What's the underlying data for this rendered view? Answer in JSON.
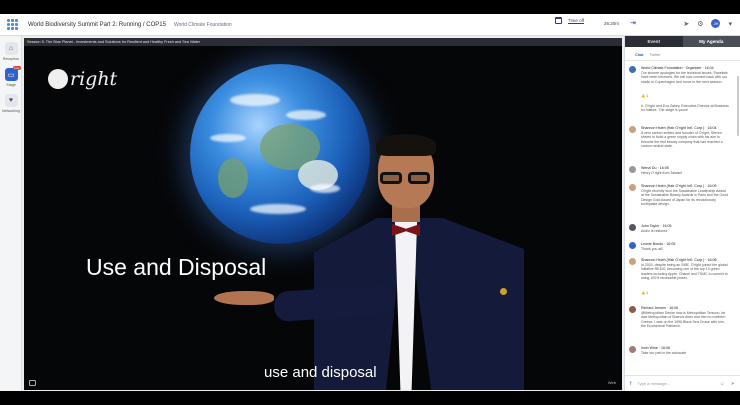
{
  "header": {
    "title": "World Biodiversity Summit Part 2: Running / COP15",
    "subtitle": "World Climate Foundation",
    "time_label": "Time off",
    "clock": "26:20m"
  },
  "rail": {
    "items": [
      {
        "label": "Reception",
        "icon": "home-icon"
      },
      {
        "label": "Stage",
        "icon": "stage-icon",
        "badge": "Live"
      },
      {
        "label": "Networking",
        "icon": "handshake-icon"
      }
    ]
  },
  "session": {
    "title": "Session 5: The Blue Planet - Investments and Solutions for Resilient and Healthy Fresh and Sea Water"
  },
  "video": {
    "brand": "right",
    "caption_big": "Use and Disposal",
    "caption_sub": "use and disposal",
    "time": "Web"
  },
  "panel": {
    "tabs": [
      "Event",
      "My Agenda"
    ],
    "subtabs": [
      "Chat",
      "Twitter"
    ],
    "messages": [
      {
        "name": "World Climate Foundation · Organizer · 16:04",
        "body": "Our sincere apologies for the technical issues. Panelists have been informed. We will now connect back with our studio in Copenhagen and move to the next session.",
        "likes": "1"
      },
      {
        "name": "",
        "body": "Ir. O'right and Eva Zabey, Executive Director at Business for Nature. The stage is yours!",
        "likes": ""
      },
      {
        "name": "Shannon Hsieh (Hair O'right Int'l. Corp.) · 16:04",
        "body": "A zero carbon emitter and founder of O'right, Steven strives to build a green supply chain with his aim to become the first beauty company that has reached a carbon neutral state.",
        "likes": ""
      },
      {
        "name": "Wenzi Du · 16:05",
        "body": "Henry O'right from Taiwan!",
        "likes": ""
      },
      {
        "name": "Shannon Hsieh (Hair O'right Int'l. Corp.) · 16:05",
        "body": "O'right recently won the Sustainable Leadership Award at the Sustainable Beauty Awards in Paris and the Good Design Gold Award of Japan for its revolutionary toothpaste design.",
        "likes": ""
      },
      {
        "name": "John Taylor · 16:05",
        "body": "Audio is restored",
        "likes": ""
      },
      {
        "name": "Leonie Bondo · 16:05",
        "body": "Thank you all!",
        "likes": ""
      },
      {
        "name": "Shannon Hsieh (Hair O'right Int'l. Corp.) · 16:06",
        "body": "In 2020, despite being an SME, O'right joined the global initiative RE100, becoming one of the top 10 green leaders including Apple, Chanel and TSMC to commit to using 100% renewable power.",
        "likes": "1"
      },
      {
        "name": "Richard Jensen · 16:06",
        "body": "@Metropolitan Desire how is Metropolitan Tersoon. he was Metropolitan of Buenos Aires and then to northern Greece. I was on the 1996 Black Sea Cruise with him, the Ecumenical Patriarch.",
        "likes": ""
      },
      {
        "name": "Irwin Wine · 16:06",
        "body": "Take our part in the advocate",
        "likes": ""
      }
    ],
    "composer_placeholder": "Type a message..."
  }
}
